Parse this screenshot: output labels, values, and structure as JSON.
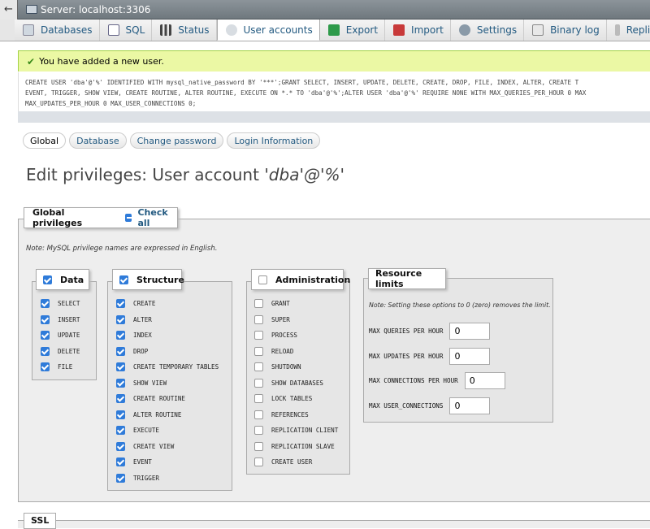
{
  "server": {
    "title": "Server: localhost:3306"
  },
  "tabs": [
    {
      "label": "Databases",
      "icon": "database-icon",
      "active": false
    },
    {
      "label": "SQL",
      "icon": "sql-icon",
      "active": false
    },
    {
      "label": "Status",
      "icon": "status-icon",
      "active": false
    },
    {
      "label": "User accounts",
      "icon": "users-icon",
      "active": true
    },
    {
      "label": "Export",
      "icon": "export-icon",
      "active": false
    },
    {
      "label": "Import",
      "icon": "import-icon",
      "active": false
    },
    {
      "label": "Settings",
      "icon": "settings-icon",
      "active": false
    },
    {
      "label": "Binary log",
      "icon": "binary-log-icon",
      "active": false
    },
    {
      "label": "Replication",
      "icon": "replication-icon",
      "active": false
    }
  ],
  "message": {
    "text": "You have added a new user."
  },
  "sql": {
    "line1": "CREATE USER 'dba'@'%' IDENTIFIED WITH mysql_native_password BY '***';GRANT SELECT, INSERT, UPDATE, DELETE, CREATE, DROP, FILE, INDEX, ALTER, CREATE T",
    "line2": "EVENT, TRIGGER, SHOW VIEW, CREATE ROUTINE, ALTER ROUTINE, EXECUTE ON *.* TO 'dba'@'%';ALTER USER 'dba'@'%' REQUIRE NONE WITH MAX_QUERIES_PER_HOUR 0 MAX",
    "line3": "MAX_UPDATES_PER_HOUR 0 MAX_USER_CONNECTIONS 0;"
  },
  "subtabs": [
    "Global",
    "Database",
    "Change password",
    "Login Information"
  ],
  "heading": {
    "prefix": "Edit privileges: User account",
    "account": "'dba'@'%'"
  },
  "global": {
    "legend": "Global privileges",
    "check_all": "Check all",
    "note": "Note: MySQL privilege names are expressed in English."
  },
  "groups": {
    "data": {
      "label": "Data",
      "checked": true,
      "items": [
        "SELECT",
        "INSERT",
        "UPDATE",
        "DELETE",
        "FILE"
      ]
    },
    "structure": {
      "label": "Structure",
      "checked": true,
      "items": [
        "CREATE",
        "ALTER",
        "INDEX",
        "DROP",
        "CREATE TEMPORARY TABLES",
        "SHOW VIEW",
        "CREATE ROUTINE",
        "ALTER ROUTINE",
        "EXECUTE",
        "CREATE VIEW",
        "EVENT",
        "TRIGGER"
      ]
    },
    "administration": {
      "label": "Administration",
      "checked": false,
      "items": [
        "GRANT",
        "SUPER",
        "PROCESS",
        "RELOAD",
        "SHUTDOWN",
        "SHOW DATABASES",
        "LOCK TABLES",
        "REFERENCES",
        "REPLICATION CLIENT",
        "REPLICATION SLAVE",
        "CREATE USER"
      ]
    }
  },
  "resources": {
    "label": "Resource limits",
    "note": "Note: Setting these options to 0 (zero) removes the limit.",
    "rows": [
      {
        "label": "MAX QUERIES PER HOUR",
        "value": "0"
      },
      {
        "label": "MAX UPDATES PER HOUR",
        "value": "0"
      },
      {
        "label": "MAX CONNECTIONS PER HOUR",
        "value": "0"
      },
      {
        "label": "MAX USER_CONNECTIONS",
        "value": "0"
      }
    ]
  },
  "ssl": {
    "label": "SSL"
  },
  "colors": {
    "link": "#235a81",
    "success_bg": "#ebf8a4",
    "checkbox": "#2f7bd9"
  }
}
